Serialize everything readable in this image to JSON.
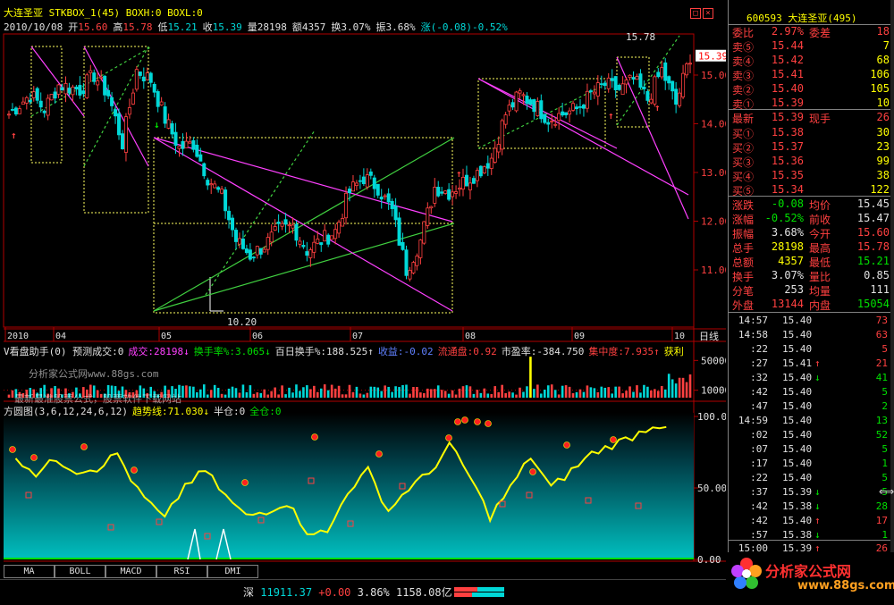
{
  "header": {
    "line1": "大连圣亚 STKBOX_1(45) BOXH:0 BOXL:0",
    "date": "2010/10/08",
    "open_label": "开",
    "open": "15.60",
    "high_label": "高",
    "high": "15.78",
    "low_label": "低",
    "low": "15.21",
    "close_label": "收",
    "close": "15.39",
    "vol_label": "量",
    "vol": "28198",
    "amt_label": "额",
    "amt": "4357",
    "turn_label": "换",
    "turn": "3.07%",
    "amp_label": "振",
    "amp": "3.68%",
    "chg_label": "涨",
    "chg": "(-0.08)-0.52%"
  },
  "main_chart": {
    "y_ticks": [
      "15.00",
      "14.00",
      "13.00",
      "12.00",
      "11.00"
    ],
    "current_price_tag": "15.39",
    "high_label": "15.78",
    "low_label": "10.20",
    "x_ticks": [
      "2010",
      "04",
      "05",
      "06",
      "07",
      "08",
      "09",
      "10"
    ],
    "period": "日线"
  },
  "indicator1": {
    "header_items": [
      {
        "text": "V看盘助手(0) 预测成交:0",
        "color": "#e0e0e0"
      },
      {
        "text": "成交:28198↓",
        "color": "#ff40ff"
      },
      {
        "text": "换手率%:3.065↓",
        "color": "#00e000"
      },
      {
        "text": "百日换手%:188.525↑",
        "color": "#e0e0e0"
      },
      {
        "text": "收益:-0.02",
        "color": "#6080ff"
      },
      {
        "text": "流通盘:0.92",
        "color": "#ff4040"
      },
      {
        "text": "市盈率:-384.750",
        "color": "#e0e0e0"
      },
      {
        "text": "集中度:7.935↑",
        "color": "#ff4040"
      },
      {
        "text": "获利",
        "color": "#ffff00"
      }
    ],
    "y_ticks": [
      "50000",
      "10000"
    ],
    "watermark1": "分析家公式网www.88gs.com",
    "watermark2": "最新最准股票公式，股票软件下载网站"
  },
  "indicator2": {
    "header_items": [
      {
        "text": "方圆图(3,6,12,24,6,12)",
        "color": "#e0e0e0"
      },
      {
        "text": "趋势线:71.030↓",
        "color": "#ffff00"
      },
      {
        "text": "半仓:0",
        "color": "#e0e0e0"
      },
      {
        "text": "全仓:0",
        "color": "#00e000"
      }
    ],
    "y_ticks": [
      "100.00",
      "50.00",
      "0.00"
    ]
  },
  "tabs": [
    "MA",
    "BOLL",
    "MACD",
    "RSI",
    "DMI"
  ],
  "panel": {
    "code": "600593",
    "name": "大连圣亚",
    "count": "(495)",
    "rows": [
      {
        "l": "委比",
        "v1": "2.97%",
        "l2": "委差",
        "v2": "18",
        "c1": "#ff4040",
        "c2": "#ff4040"
      },
      {
        "l": "卖⑤",
        "v1": "15.44",
        "l2": "",
        "v2": "7",
        "c1": "#ff4040",
        "c2": "#ffff00"
      },
      {
        "l": "卖④",
        "v1": "15.42",
        "l2": "",
        "v2": "68",
        "c1": "#ff4040",
        "c2": "#ffff00"
      },
      {
        "l": "卖③",
        "v1": "15.41",
        "l2": "",
        "v2": "106",
        "c1": "#ff4040",
        "c2": "#ffff00"
      },
      {
        "l": "卖②",
        "v1": "15.40",
        "l2": "",
        "v2": "105",
        "c1": "#ff4040",
        "c2": "#ffff00"
      },
      {
        "l": "卖①",
        "v1": "15.39",
        "l2": "",
        "v2": "10",
        "c1": "#ff4040",
        "c2": "#ffff00"
      },
      {
        "l": "最新",
        "v1": "15.39",
        "l2": "现手",
        "v2": "26",
        "c1": "#ff4040",
        "c2": "#ff4040"
      },
      {
        "l": "买①",
        "v1": "15.38",
        "l2": "",
        "v2": "30",
        "c1": "#ff4040",
        "c2": "#ffff00"
      },
      {
        "l": "买②",
        "v1": "15.37",
        "l2": "",
        "v2": "23",
        "c1": "#ff4040",
        "c2": "#ffff00"
      },
      {
        "l": "买③",
        "v1": "15.36",
        "l2": "",
        "v2": "99",
        "c1": "#ff4040",
        "c2": "#ffff00"
      },
      {
        "l": "买④",
        "v1": "15.35",
        "l2": "",
        "v2": "38",
        "c1": "#ff4040",
        "c2": "#ffff00"
      },
      {
        "l": "买⑤",
        "v1": "15.34",
        "l2": "",
        "v2": "122",
        "c1": "#ff4040",
        "c2": "#ffff00"
      },
      {
        "l": "涨跌",
        "v1": "-0.08",
        "l2": "均价",
        "v2": "15.45",
        "c1": "#00e000",
        "c2": "#e0e0e0"
      },
      {
        "l": "涨幅",
        "v1": "-0.52%",
        "l2": "前收",
        "v2": "15.47",
        "c1": "#00e000",
        "c2": "#e0e0e0"
      },
      {
        "l": "振幅",
        "v1": "3.68%",
        "l2": "今开",
        "v2": "15.60",
        "c1": "#e0e0e0",
        "c2": "#ff4040"
      },
      {
        "l": "总手",
        "v1": "28198",
        "l2": "最高",
        "v2": "15.78",
        "c1": "#ffff00",
        "c2": "#ff4040"
      },
      {
        "l": "总额",
        "v1": "4357",
        "l2": "最低",
        "v2": "15.21",
        "c1": "#ffff00",
        "c2": "#00e000"
      },
      {
        "l": "换手",
        "v1": "3.07%",
        "l2": "量比",
        "v2": "0.85",
        "c1": "#e0e0e0",
        "c2": "#e0e0e0"
      },
      {
        "l": "分笔",
        "v1": "253",
        "l2": "均量",
        "v2": "111",
        "c1": "#e0e0e0",
        "c2": "#e0e0e0"
      },
      {
        "l": "外盘",
        "v1": "13144",
        "l2": "内盘",
        "v2": "15054",
        "c1": "#ff4040",
        "c2": "#00e000"
      }
    ],
    "ticks": [
      {
        "t": "14:57",
        "p": "15.40",
        "a": "",
        "v": "73",
        "c": "#ff4040"
      },
      {
        "t": "14:58",
        "p": "15.40",
        "a": "",
        "v": "63",
        "c": "#ff4040"
      },
      {
        "t": ":22",
        "p": "15.40",
        "a": "",
        "v": "5",
        "c": "#ff4040"
      },
      {
        "t": ":27",
        "p": "15.41",
        "a": "↑",
        "v": "21",
        "c": "#ff4040"
      },
      {
        "t": ":32",
        "p": "15.40",
        "a": "↓",
        "v": "41",
        "c": "#00e000"
      },
      {
        "t": ":42",
        "p": "15.40",
        "a": "",
        "v": "5",
        "c": "#00e000"
      },
      {
        "t": ":47",
        "p": "15.40",
        "a": "",
        "v": "2",
        "c": "#00e000"
      },
      {
        "t": "14:59",
        "p": "15.40",
        "a": "",
        "v": "13",
        "c": "#00e000"
      },
      {
        "t": ":02",
        "p": "15.40",
        "a": "",
        "v": "52",
        "c": "#00e000"
      },
      {
        "t": ":07",
        "p": "15.40",
        "a": "",
        "v": "5",
        "c": "#00e000"
      },
      {
        "t": ":17",
        "p": "15.40",
        "a": "",
        "v": "1",
        "c": "#00e000"
      },
      {
        "t": ":22",
        "p": "15.40",
        "a": "",
        "v": "5",
        "c": "#00e000"
      },
      {
        "t": ":37",
        "p": "15.39",
        "a": "↓",
        "v": "5",
        "c": "#00e000"
      },
      {
        "t": ":42",
        "p": "15.38",
        "a": "↓",
        "v": "28",
        "c": "#00e000"
      },
      {
        "t": ":42",
        "p": "15.40",
        "a": "↑",
        "v": "17",
        "c": "#ff4040"
      },
      {
        "t": ":57",
        "p": "15.38",
        "a": "↓",
        "v": "1",
        "c": "#00e000"
      },
      {
        "t": "15:00",
        "p": "15.39",
        "a": "↑",
        "v": "26",
        "c": "#ff4040"
      }
    ]
  },
  "status": {
    "market": "深",
    "index": "11911.37",
    "change": "+0.00",
    "pct": "3.86%",
    "amount": "1158.08亿"
  },
  "logo": {
    "title": "分析家公式网",
    "url": "www.88gs.com"
  },
  "colors": {
    "up": "#ff4040",
    "down": "#00d8d8",
    "grid": "#b00000",
    "box": "#ffff60",
    "trend_green": "#40d040",
    "trend_magenta": "#ff40ff",
    "trendline": "#ffff00"
  }
}
